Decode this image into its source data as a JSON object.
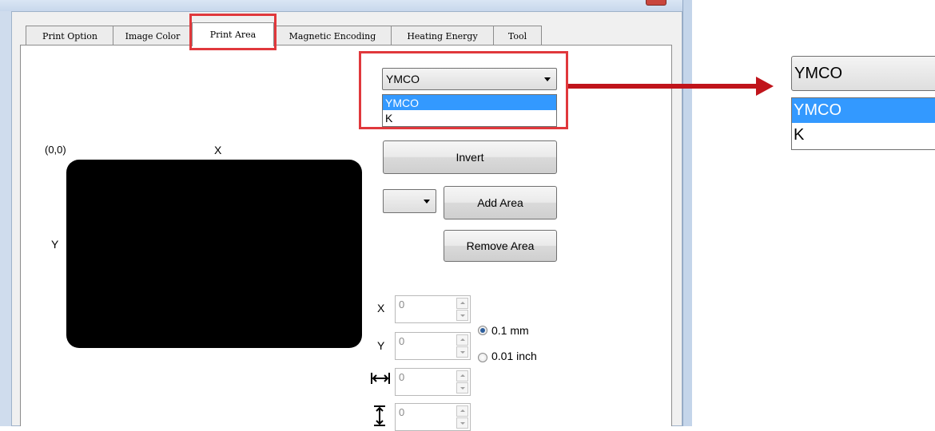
{
  "tabs": [
    {
      "label": "Print Option",
      "active": false
    },
    {
      "label": "Image Color",
      "active": false
    },
    {
      "label": "Print Area",
      "active": true
    },
    {
      "label": "Magnetic Encoding",
      "active": false
    },
    {
      "label": "Heating Energy",
      "active": false
    },
    {
      "label": "Tool",
      "active": false
    }
  ],
  "panel_dropdown": {
    "selected": "YMCO",
    "options": [
      {
        "label": "YMCO",
        "selected": true
      },
      {
        "label": "K",
        "selected": false
      }
    ]
  },
  "zoomed_dropdown": {
    "selected": "YMCO",
    "options": [
      {
        "label": "YMCO",
        "selected": true
      },
      {
        "label": "K",
        "selected": false
      }
    ]
  },
  "preview": {
    "origin_label": "(0,0)",
    "x_axis_label": "X",
    "y_axis_label": "Y"
  },
  "buttons": {
    "invert": "Invert",
    "add_area": "Add Area",
    "remove_area": "Remove Area"
  },
  "area_dropdown": {
    "selected": ""
  },
  "fields": {
    "x": {
      "label": "X",
      "value": "0"
    },
    "y": {
      "label": "Y",
      "value": "0"
    },
    "width": {
      "value": "0"
    },
    "height": {
      "value": "0"
    }
  },
  "units": [
    {
      "label": "0.1 mm",
      "checked": true
    },
    {
      "label": "0.01 inch",
      "checked": false
    }
  ],
  "colors": {
    "highlight_red": "#e0383c",
    "arrow_red": "#c0141b",
    "selection_blue": "#3399ff"
  }
}
